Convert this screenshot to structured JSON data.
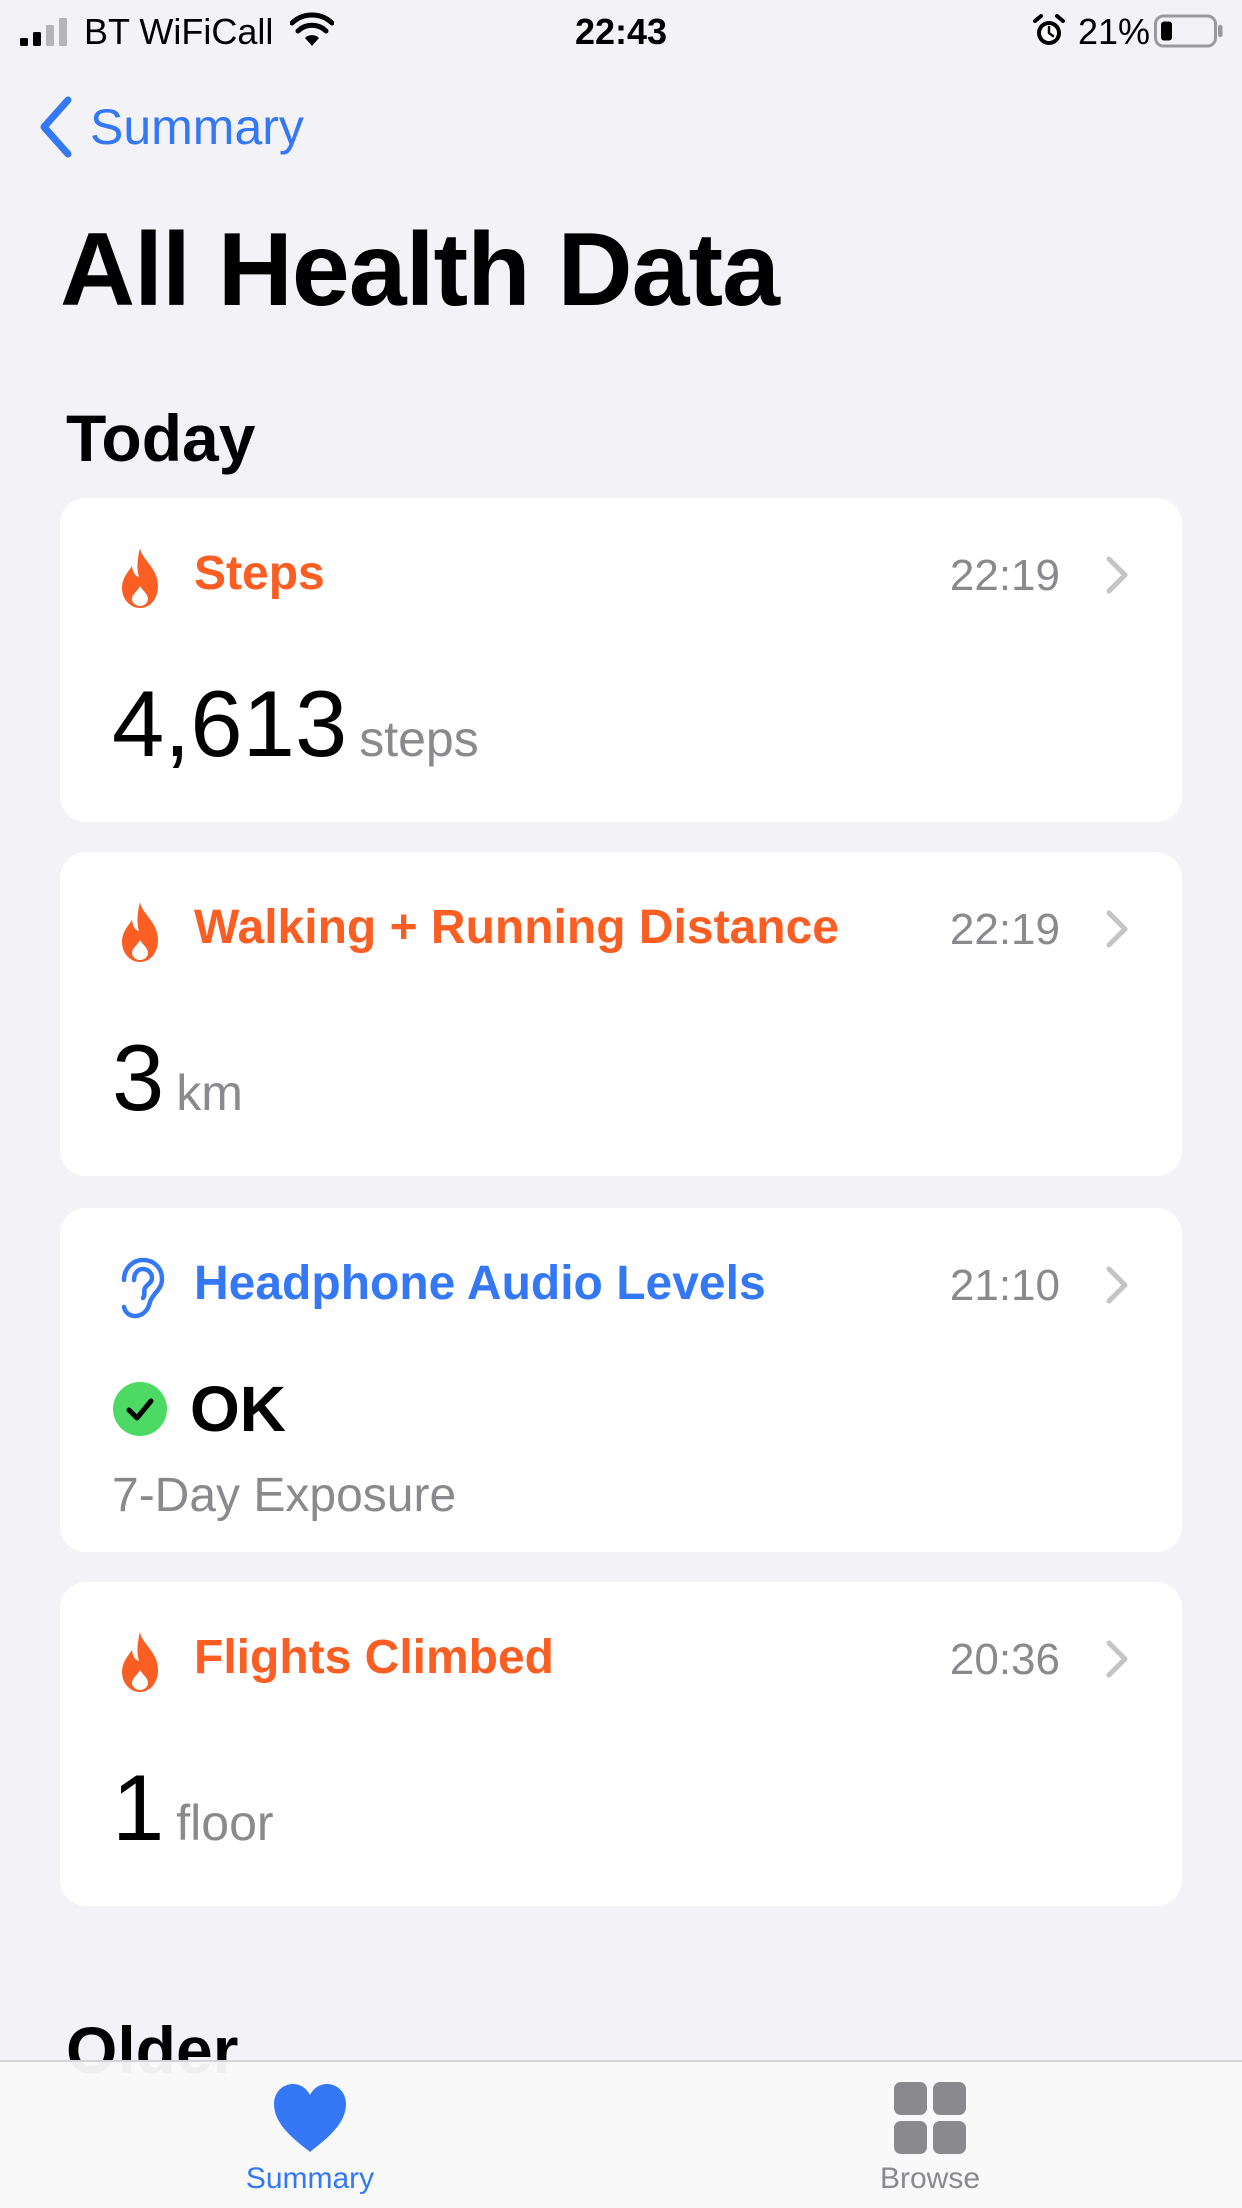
{
  "status_bar": {
    "carrier": "BT WiFiCall",
    "time": "22:43",
    "battery_percent": "21%"
  },
  "nav": {
    "back_label": "Summary"
  },
  "page_title": "All Health Data",
  "sections": {
    "today": "Today",
    "older": "Older"
  },
  "cards": [
    {
      "title": "Steps",
      "time": "22:19",
      "value": "4,613",
      "unit": "steps",
      "icon": "flame-icon"
    },
    {
      "title": "Walking + Running Distance",
      "time": "22:19",
      "value": "3",
      "unit": "km",
      "icon": "flame-icon"
    },
    {
      "title": "Headphone Audio Levels",
      "time": "21:10",
      "status": "OK",
      "subtitle": "7-Day Exposure",
      "icon": "ear-icon"
    },
    {
      "title": "Flights Climbed",
      "time": "20:36",
      "value": "1",
      "unit": "floor",
      "icon": "flame-icon"
    }
  ],
  "tab_bar": {
    "tabs": [
      {
        "label": "Summary",
        "icon": "heart-icon",
        "selected": true
      },
      {
        "label": "Browse",
        "icon": "grid-icon",
        "selected": false
      }
    ]
  },
  "colors": {
    "accent_orange": "#fa5e23",
    "accent_blue": "#3478f6",
    "ok_green": "#4cd964",
    "background": "#f2f2f7"
  }
}
